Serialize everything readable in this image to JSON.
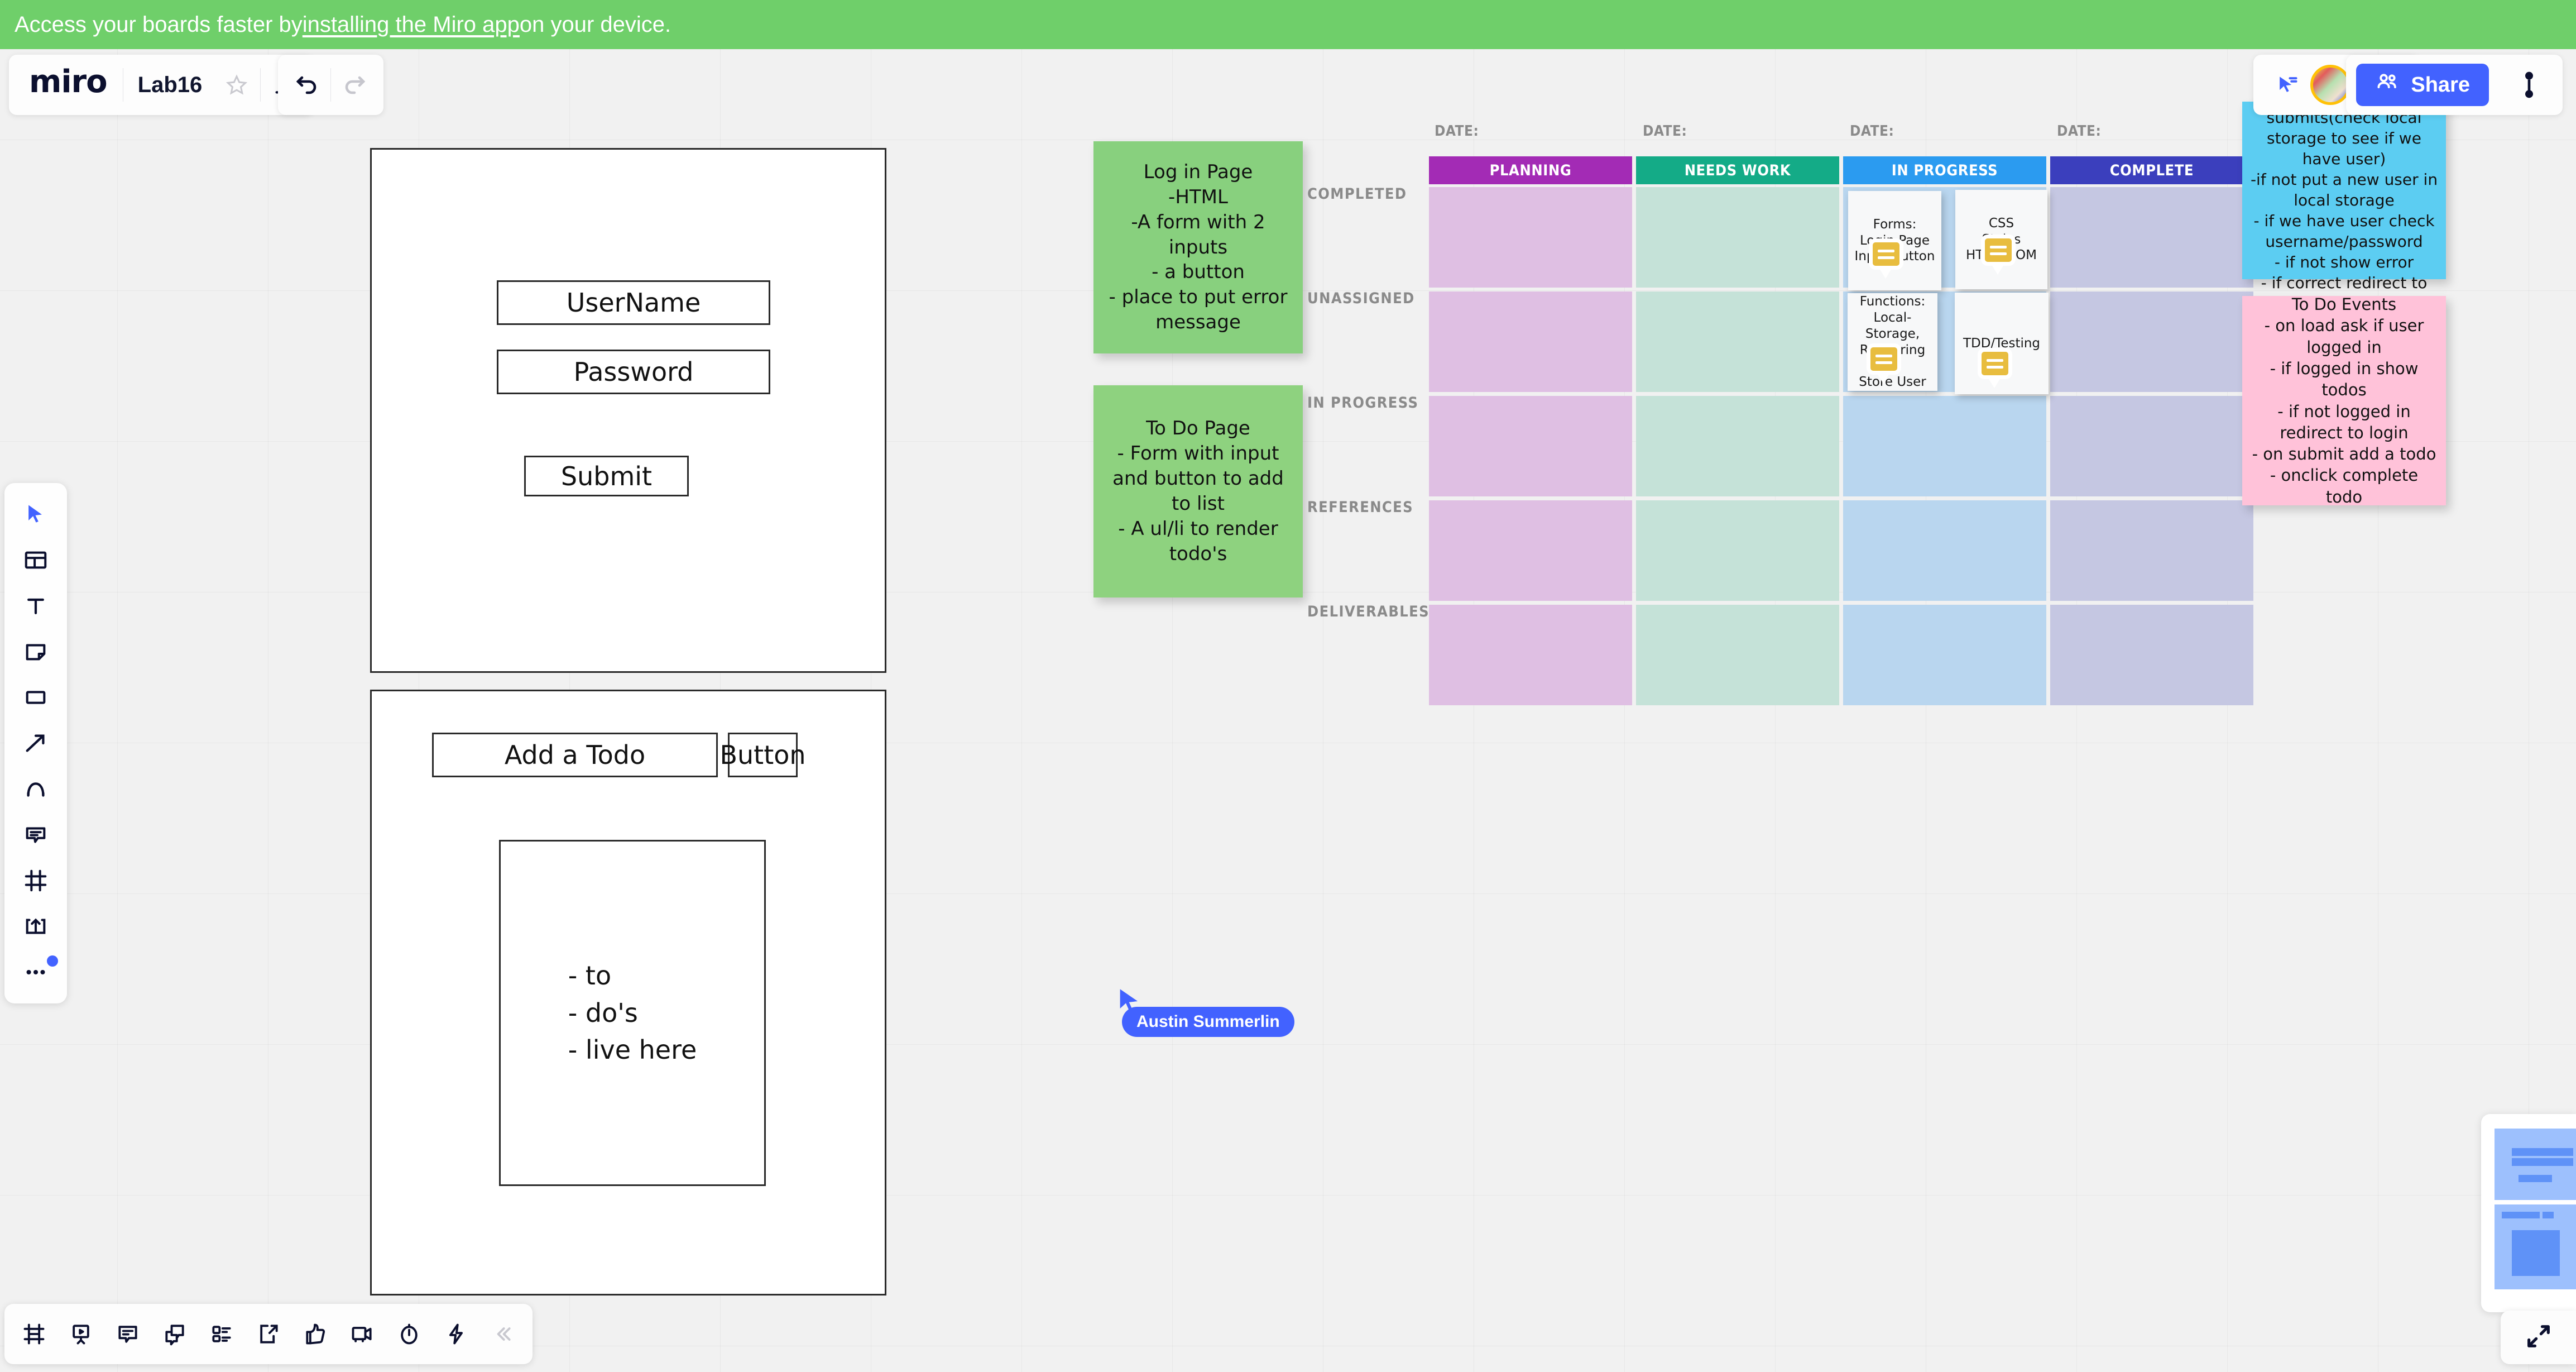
{
  "banner": {
    "text_before": "Access your boards faster by ",
    "link": "installing the Miro app",
    "text_after": " on your device."
  },
  "header": {
    "logo": "miro",
    "board_name": "Lab16",
    "star_icon": "star-icon",
    "upload_icon": "upload-icon",
    "undo_icon": "undo-icon",
    "redo_icon": "redo-icon",
    "cursor_share_icon": "cursor-share-icon",
    "share_label": "Share",
    "share_icon": "people-icon",
    "accent_color": "#4262ff",
    "banner_color": "#6fcf6a"
  },
  "left_toolbar": {
    "items": [
      {
        "name": "select-tool",
        "icon": "cursor-icon"
      },
      {
        "name": "templates-tool",
        "icon": "templates-icon"
      },
      {
        "name": "text-tool",
        "icon": "text-icon"
      },
      {
        "name": "sticky-note-tool",
        "icon": "sticky-note-icon"
      },
      {
        "name": "shape-tool",
        "icon": "rectangle-icon"
      },
      {
        "name": "connector-tool",
        "icon": "arrow-icon"
      },
      {
        "name": "pen-tool",
        "icon": "pen-icon"
      },
      {
        "name": "comment-tool",
        "icon": "comment-icon"
      },
      {
        "name": "frame-tool",
        "icon": "frame-icon"
      },
      {
        "name": "upload-tool",
        "icon": "upload-box-icon"
      },
      {
        "name": "more-tools",
        "icon": "more-dots-icon",
        "badge": true
      }
    ]
  },
  "bottom_toolbar": {
    "items": [
      {
        "name": "frames-panel",
        "icon": "frames-icon"
      },
      {
        "name": "presentation",
        "icon": "presentation-icon"
      },
      {
        "name": "comments-panel",
        "icon": "comment-list-icon"
      },
      {
        "name": "chat-panel",
        "icon": "chat-icon"
      },
      {
        "name": "cards-panel",
        "icon": "card-list-icon"
      },
      {
        "name": "export-panel",
        "icon": "export-icon"
      },
      {
        "name": "reactions",
        "icon": "thumbs-up-icon"
      },
      {
        "name": "video-chat",
        "icon": "video-icon"
      },
      {
        "name": "timer",
        "icon": "timer-icon"
      },
      {
        "name": "apps",
        "icon": "lightning-icon"
      },
      {
        "name": "collapse-toolbar",
        "icon": "chevron-left-double-icon"
      }
    ]
  },
  "mockups": {
    "login": {
      "username_field": "UserName",
      "password_field": "Password",
      "submit_button": "Submit"
    },
    "todo": {
      "input_field": "Add a Todo",
      "button": "Button",
      "list_text": "- to\n- do's\n- live here"
    }
  },
  "sticky_notes": [
    {
      "name": "note-login-page",
      "color": "#88d07e",
      "text": "Log in Page\n-HTML\n-A form with 2 inputs\n- a button\n- place to put error message"
    },
    {
      "name": "note-todo-page",
      "color": "#8ed27f",
      "text": "To Do Page\n- Form with input and button to add to list\n- A ul/li to render todo's"
    },
    {
      "name": "note-events-login-page",
      "color": "#5ccdf2",
      "text": "Events Login Page\n- When user submits(check local storage to see if we have user)\n-if not put a new user in local storage\n- if we have user check username/password\n- if not show error\n- if correct redirect to todo's page"
    },
    {
      "name": "note-todo-events",
      "color": "#ffc2d9",
      "text": "To Do Events\n- on load ask if user logged in\n- if logged in show todos\n- if not logged in redirect to login\n- on submit add a todo\n- onclick complete todo"
    }
  ],
  "kanban": {
    "date_label": "DATE:",
    "columns": [
      {
        "label": "PLANNING",
        "header_color": "#a32bb5",
        "cell_color": "#dfbfe3"
      },
      {
        "label": "NEEDS WORK",
        "header_color": "#14ab87",
        "cell_color": "#c5e2d8"
      },
      {
        "label": "IN PROGRESS",
        "header_color": "#2b9bf0",
        "cell_color": "#b9d6ef"
      },
      {
        "label": "COMPLETE",
        "header_color": "#3b3fbd",
        "cell_color": "#c5c7e2"
      }
    ],
    "rows": [
      "COMPLETED",
      "UNASSIGNED",
      "IN PROGRESS",
      "REFERENCES",
      "DELIVERABLES"
    ],
    "cards": [
      {
        "name": "card-forms",
        "text": "Forms:\nLogin Page\nInput Button",
        "col": 2,
        "row": 0,
        "slot": 0,
        "comment": true
      },
      {
        "name": "card-css",
        "text": "CSS\nStyles\nHTML DOM",
        "col": 2,
        "row": 0,
        "slot": 1,
        "comment": true
      },
      {
        "name": "card-functions",
        "text": "Functions:\nLocal-Storage,\nRendering\n\nStore User",
        "col": 2,
        "row": 1,
        "slot": 0,
        "comment": true
      },
      {
        "name": "card-tdd",
        "text": "TDD/Testing",
        "col": 2,
        "row": 1,
        "slot": 1,
        "comment": true
      }
    ]
  },
  "remote_user": {
    "name": "Austin Summerlin",
    "color": "#4262ff"
  },
  "minimap": {
    "expand_icon": "expand-icon"
  }
}
